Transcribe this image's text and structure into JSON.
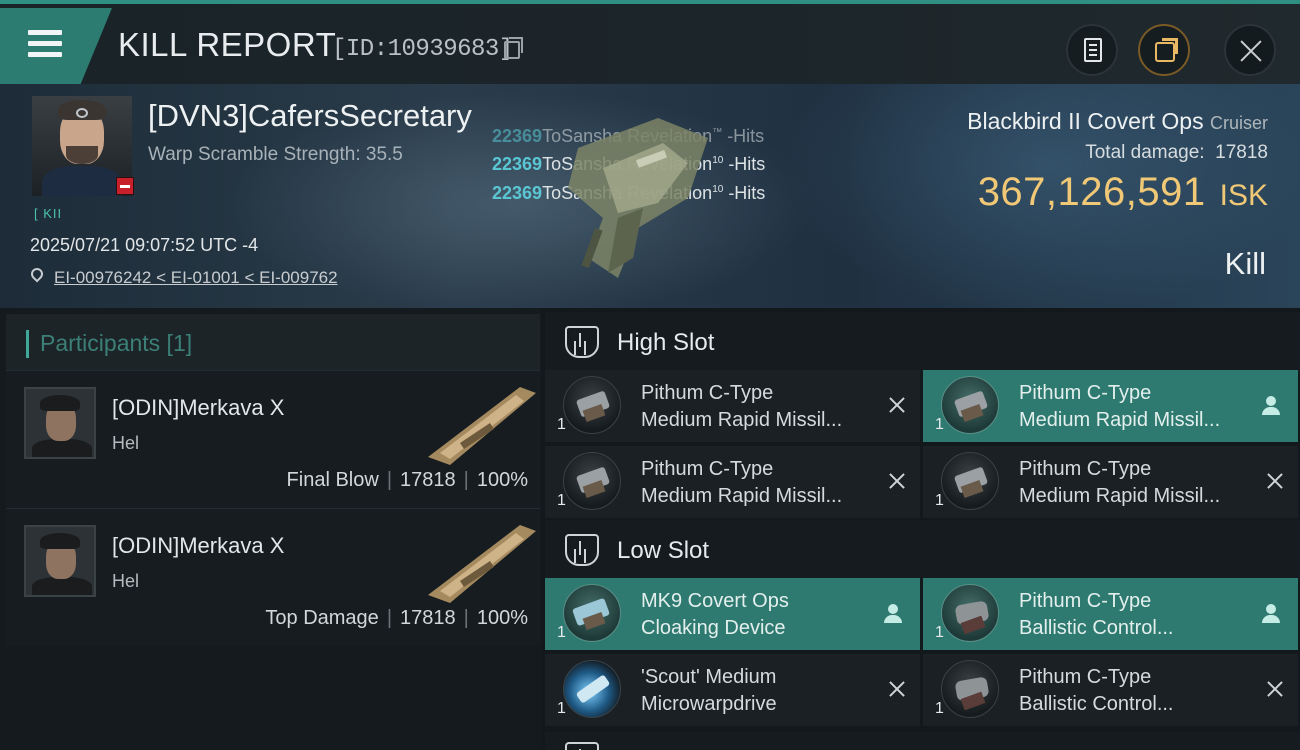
{
  "header": {
    "title": "KILL REPORT",
    "kill_id": "[ID:10939683]",
    "icons": [
      "menu-icon",
      "copy-icon",
      "report-icon",
      "share-icon",
      "close-icon"
    ]
  },
  "victim": {
    "name": "[DVN3]CafersSecretary",
    "warp_scramble": "Warp Scramble Strength: 35.5",
    "corp_tag": "[ KII",
    "timestamp": "2025/07/21 09:07:52 UTC -4",
    "location": "EI-00976242 < EI-01001 < EI-009762"
  },
  "hits": [
    {
      "amount": "22369",
      "text": "ToSansha Revelation",
      "sup": "™",
      "suffix": " -Hits"
    },
    {
      "amount": "22369",
      "text": "ToSansha Revelation",
      "sup": "10",
      "suffix": " -Hits"
    },
    {
      "amount": "22369",
      "text": "ToSansha Revelation",
      "sup": "10",
      "suffix": " -Hits"
    }
  ],
  "ship": {
    "name": "Blackbird II Covert Ops",
    "class": "Cruiser",
    "total_damage_label": "Total damage:",
    "total_damage": "17818",
    "isk_value": "367,126,591",
    "isk_unit": "ISK",
    "type": "Kill"
  },
  "participants": {
    "header": "Participants [1]",
    "rows": [
      {
        "name": "[ODIN]Merkava X",
        "ship": "Hel",
        "role": "Final Blow",
        "damage": "17818",
        "percent": "100%"
      },
      {
        "name": "[ODIN]Merkava X",
        "ship": "Hel",
        "role": "Top Damage",
        "damage": "17818",
        "percent": "100%"
      }
    ]
  },
  "slots": {
    "high": {
      "title": "High Slot",
      "modules": [
        {
          "qty": "1",
          "line1": "Pithum C-Type",
          "line2": "Medium Rapid Missil...",
          "status": "destroyed"
        },
        {
          "qty": "1",
          "line1": "Pithum C-Type",
          "line2": "Medium Rapid Missil...",
          "status": "dropped"
        },
        {
          "qty": "1",
          "line1": "Pithum C-Type",
          "line2": "Medium Rapid Missil...",
          "status": "destroyed"
        },
        {
          "qty": "1",
          "line1": "Pithum C-Type",
          "line2": "Medium Rapid Missil...",
          "status": "destroyed"
        }
      ]
    },
    "low": {
      "title": "Low Slot",
      "modules": [
        {
          "qty": "1",
          "line1": "MK9 Covert Ops",
          "line2": "Cloaking Device",
          "status": "dropped"
        },
        {
          "qty": "1",
          "line1": "Pithum C-Type",
          "line2": "Ballistic Control...",
          "status": "dropped"
        },
        {
          "qty": "1",
          "line1": "'Scout' Medium",
          "line2": "Microwarpdrive",
          "status": "destroyed"
        },
        {
          "qty": "1",
          "line1": "Pithum C-Type",
          "line2": "Ballistic Control...",
          "status": "destroyed"
        }
      ]
    }
  },
  "colors": {
    "accent_teal": "#2f7a70",
    "isk_gold": "#f0c876",
    "hit_cyan": "#5bc6d3",
    "danger_red": "#c8202a"
  }
}
